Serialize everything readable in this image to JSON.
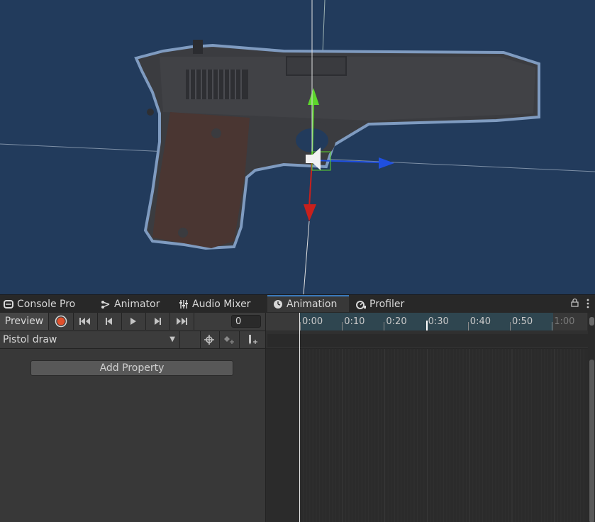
{
  "tabs": [
    {
      "label": "Console Pro",
      "icon": "console-icon"
    },
    {
      "label": "Animator",
      "icon": "animator-icon"
    },
    {
      "label": "Audio Mixer",
      "icon": "audio-mixer-icon"
    },
    {
      "label": "Animation",
      "icon": "clock-icon",
      "active": true
    },
    {
      "label": "Profiler",
      "icon": "profiler-icon"
    }
  ],
  "toolbar": {
    "preview_label": "Preview",
    "frame_value": "0"
  },
  "clip": {
    "name": "Pistol draw"
  },
  "add_property_label": "Add Property",
  "timeline": {
    "ticks": [
      "0:00",
      "0:10",
      "0:20",
      "0:30",
      "0:40",
      "0:50",
      "1:00"
    ]
  },
  "colors": {
    "scene_bg": "#223b5c",
    "record": "#e0502c",
    "tab_accent": "#3a79bb",
    "gizmo_y": "#5dd62c",
    "gizmo_z": "#1f4fe0",
    "gizmo_x": "#c8201c"
  }
}
